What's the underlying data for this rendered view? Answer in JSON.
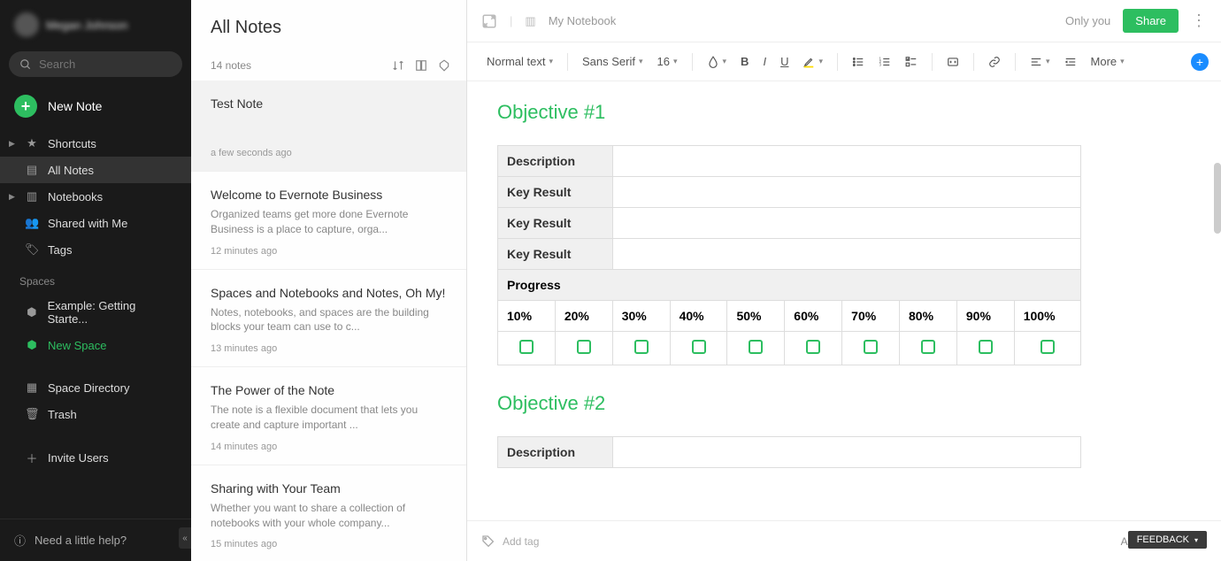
{
  "sidebar": {
    "user": {
      "name": "Megan Johnson"
    },
    "search_placeholder": "Search",
    "new_note": "New Note",
    "nav": {
      "shortcuts": "Shortcuts",
      "all_notes": "All Notes",
      "notebooks": "Notebooks",
      "shared": "Shared with Me",
      "tags": "Tags"
    },
    "spaces_label": "Spaces",
    "spaces": {
      "example": "Example: Getting Starte...",
      "new_space": "New Space"
    },
    "space_directory": "Space Directory",
    "trash": "Trash",
    "invite": "Invite Users",
    "help": "Need a little help?"
  },
  "notelist": {
    "title": "All Notes",
    "count": "14 notes",
    "items": [
      {
        "title": "Test Note",
        "preview": "",
        "time": "a few seconds ago",
        "selected": true
      },
      {
        "title": "Welcome to Evernote Business",
        "preview": "Organized teams get more done Evernote Business is a place to capture, orga...",
        "time": "12 minutes ago"
      },
      {
        "title": "Spaces and Notebooks and Notes, Oh My!",
        "preview": "Notes, notebooks, and spaces are the building blocks your team can use to c...",
        "time": "13 minutes ago"
      },
      {
        "title": "The Power of the Note",
        "preview": "The note is a flexible document that lets you create and capture important ...",
        "time": "14 minutes ago"
      },
      {
        "title": "Sharing with Your Team",
        "preview": "Whether you want to share a collection of notebooks with your whole company...",
        "time": "15 minutes ago"
      }
    ]
  },
  "editor": {
    "notebook": "My Notebook",
    "only_you": "Only you",
    "share": "Share",
    "toolbar": {
      "text_style": "Normal text",
      "font": "Sans Serif",
      "size": "16",
      "more": "More"
    },
    "content": {
      "obj1_title": "Objective #1",
      "obj2_title": "Objective #2",
      "rows": {
        "description": "Description",
        "key_result": "Key Result",
        "progress": "Progress"
      },
      "percents": [
        "10%",
        "20%",
        "30%",
        "40%",
        "50%",
        "60%",
        "70%",
        "80%",
        "90%",
        "100%"
      ]
    },
    "footer": {
      "add_tag": "Add tag",
      "saved": "All changes saved",
      "feedback": "FEEDBACK"
    }
  }
}
